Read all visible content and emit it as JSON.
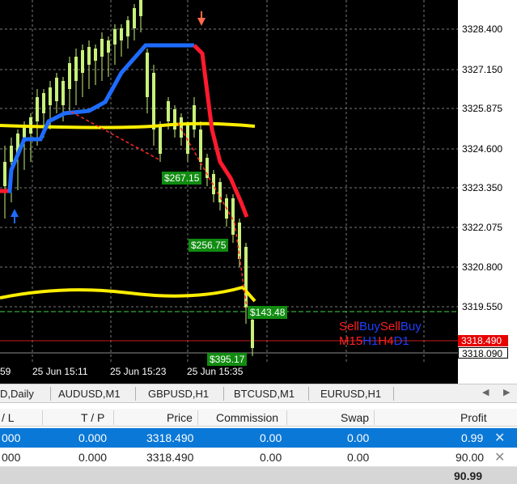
{
  "chart": {
    "price_axis": [
      "3328.400",
      "3327.150",
      "3325.875",
      "3324.600",
      "3323.350",
      "3322.075",
      "3320.800",
      "3319.550",
      "3318.490",
      "3318.090"
    ],
    "bid_price": "3318.490",
    "current_price": "3318.090",
    "time_labels": [
      "59",
      "25 Jun 15:11",
      "25 Jun 15:23",
      "25 Jun 15:35"
    ],
    "profit_tags": [
      "$267.15",
      "$256.75",
      "$143.48",
      "$395.17"
    ],
    "timeframe_signals": {
      "row1": [
        {
          "text": "Sell",
          "color": "red"
        },
        {
          "text": "Buy",
          "color": "blue"
        },
        {
          "text": "Sell",
          "color": "red"
        },
        {
          "text": "Buy",
          "color": "blue"
        }
      ],
      "row2": [
        {
          "text": "M15",
          "color": "red"
        },
        {
          "text": "H1",
          "color": "blue"
        },
        {
          "text": "H4",
          "color": "red"
        },
        {
          "text": "D1",
          "color": "blue"
        }
      ]
    },
    "colors": {
      "background": "#000000",
      "bull_candle": "#c8f07a",
      "trend_up": "#1e6cff",
      "trend_down": "#ff1a2e",
      "bands": "#ffee00",
      "grid": "#7a7a7a",
      "trade_line": "#ff2a2a"
    }
  },
  "tabs": [
    "D,Daily",
    "AUDUSD,M1",
    "GBPUSD,H1",
    "BTCUSD,M1",
    "EURUSD,H1"
  ],
  "terminal": {
    "columns": [
      "/ L",
      "T / P",
      "Price",
      "Commission",
      "Swap",
      "Profit"
    ],
    "rows": [
      {
        "sl": "000",
        "tp": "0.000",
        "price": "3318.490",
        "commission": "0.00",
        "swap": "0.00",
        "profit": "0.99",
        "selected": true
      },
      {
        "sl": "000",
        "tp": "0.000",
        "price": "3318.490",
        "commission": "0.00",
        "swap": "0.00",
        "profit": "90.00",
        "selected": false
      }
    ],
    "total_profit": "90.99"
  }
}
